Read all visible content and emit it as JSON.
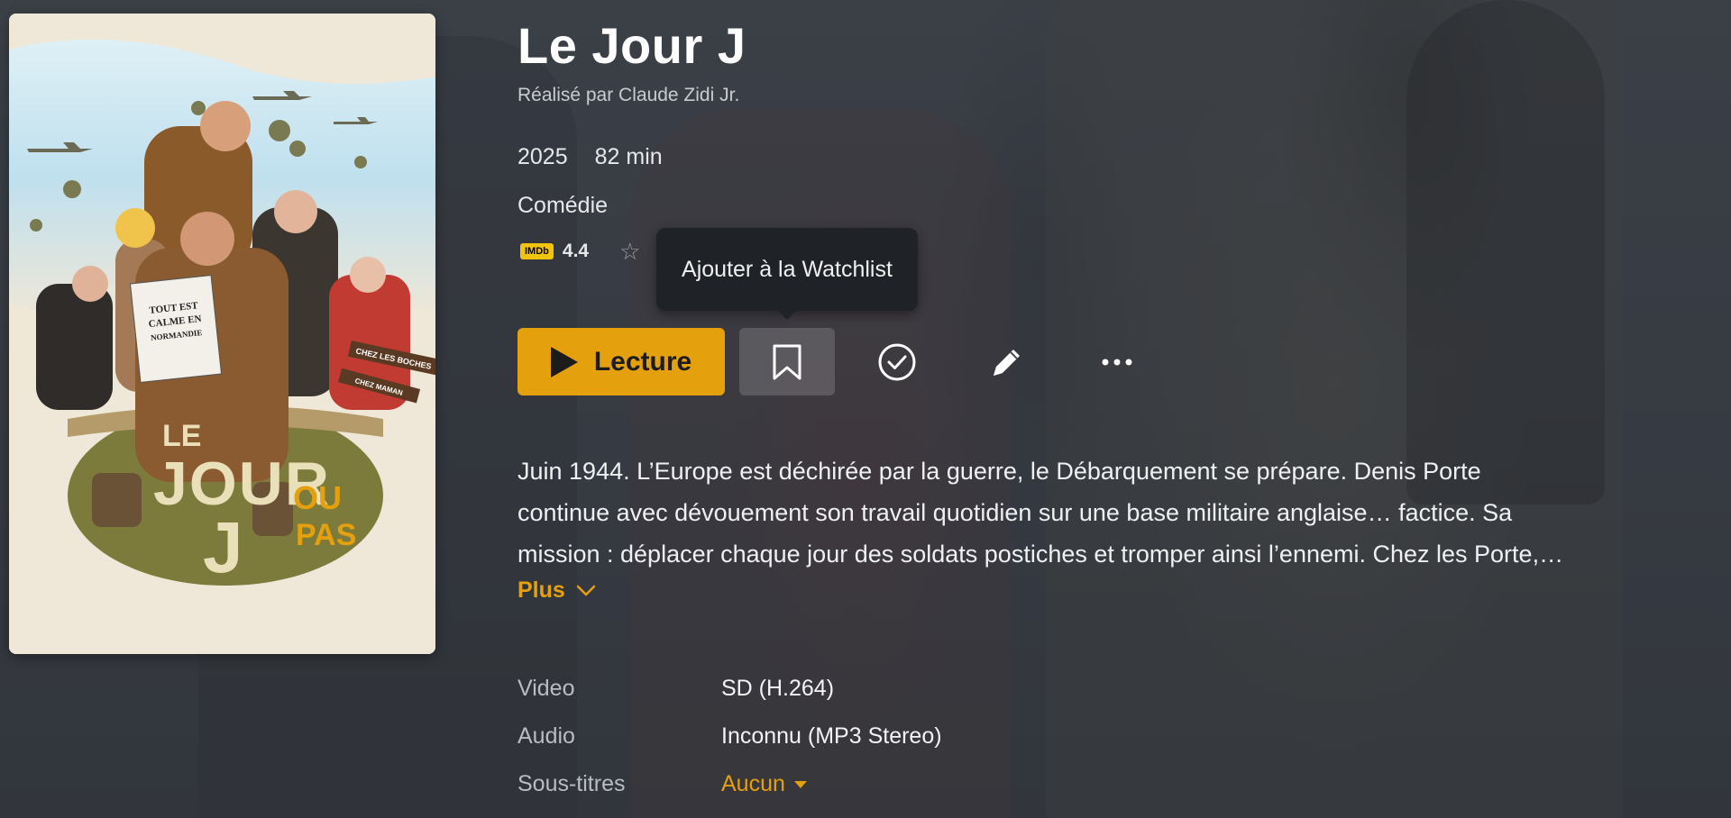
{
  "movie": {
    "title": "Le Jour J",
    "director": "Réalisé par Claude Zidi Jr.",
    "year": "2025",
    "duration": "82 min",
    "genre": "Comédie",
    "imdb_label": "IMDb",
    "imdb_rating": "4.4"
  },
  "tooltip": {
    "text": "Ajouter à la Watchlist"
  },
  "actions": {
    "play_label": "Lecture",
    "buttons": [
      {
        "icon": "bookmark-icon",
        "state": "hover"
      },
      {
        "icon": "check-circle-icon"
      },
      {
        "icon": "pencil-icon"
      },
      {
        "icon": "more-icon"
      }
    ]
  },
  "summary": {
    "lines": [
      "Juin 1944. L’Europe est déchirée par la guerre, le Débarquement se prépare. Denis Porte",
      "continue avec dévouement son travail quotidien sur une base militaire anglaise… factice. Sa",
      "mission : déplacer chaque jour des soldats postiches et tromper ainsi l’ennemi. Chez les Porte,…"
    ],
    "more_label": "Plus"
  },
  "details": {
    "video_label": "Video",
    "video_value": "SD (H.264)",
    "audio_label": "Audio",
    "audio_value": "Inconnu (MP3 Stereo)",
    "subtitles_label": "Sous-titres",
    "subtitles_value": "Aucun"
  },
  "poster": {
    "title_line1": "LE",
    "title_line2": "JOUR",
    "title_line3": "J",
    "tagline": "OU PAS",
    "newspaper": "TOUT EST CALME EN NORMANDIE",
    "sign1": "CHEZ LES BOCHES",
    "sign2": "CHEZ MAMAN"
  },
  "colors": {
    "accent": "#e5a00d",
    "imdb": "#f2c40d",
    "tooltip_bg": "#1f2226"
  }
}
